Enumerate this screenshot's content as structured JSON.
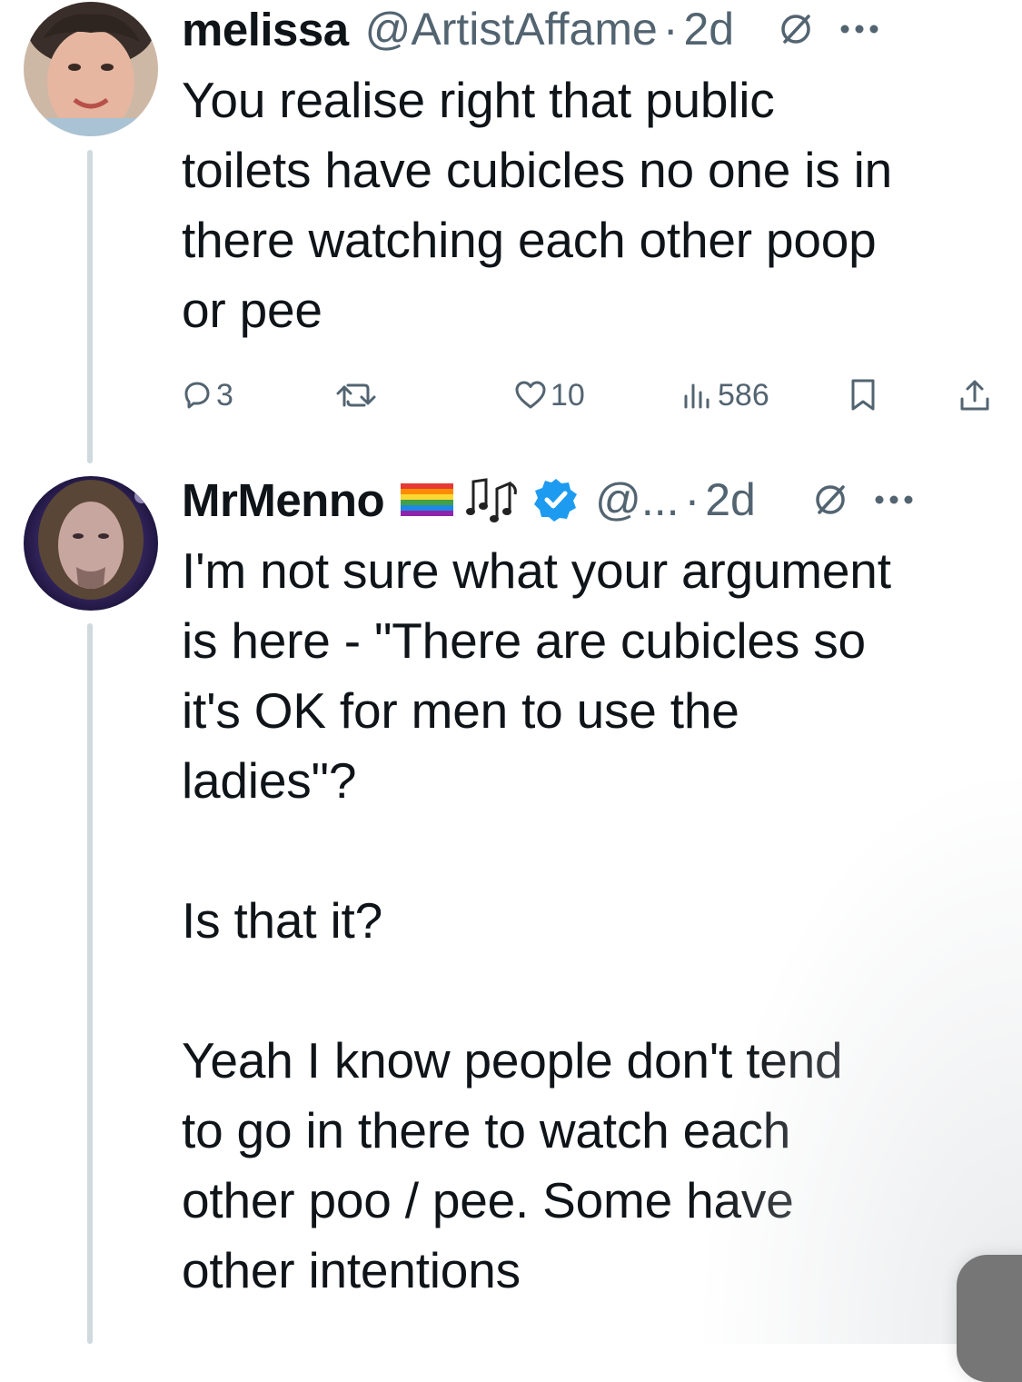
{
  "tweets": [
    {
      "author_name": "melissa",
      "handle": "@ArtistAffame",
      "separator": "·",
      "time": "2d",
      "text": "You realise right that public\ntoilets have cubicles no one is in\nthere watching each other poop\nor pee",
      "actions": {
        "reply_count": "3",
        "repost_count": "",
        "like_count": "10",
        "view_count": "586"
      },
      "icons": {
        "reply": "reply-icon",
        "repost": "repost-icon",
        "like": "heart-icon",
        "views": "views-chart-icon",
        "bookmark": "bookmark-icon",
        "share": "share-icon",
        "grok": "grok-icon",
        "more": "more-dots-icon"
      }
    },
    {
      "author_name": "MrMenno",
      "badges": [
        "rainbow-flag-emoji",
        "music-notes-emoji",
        "verified-badge"
      ],
      "handle": "@...",
      "separator": "·",
      "time": "2d",
      "text": "I'm not sure what your argument\nis here - \"There are cubicles so\nit's OK for men to use the\nladies\"?\n\nIs that it?\n\nYeah I know people don't tend\nto go in there to watch each\nother poo / pee. Some have\nother intentions",
      "icons": {
        "grok": "grok-icon",
        "more": "more-dots-icon"
      }
    }
  ],
  "colors": {
    "text": "#0f1419",
    "secondary": "#536471",
    "thread_line": "#cfd9de",
    "verified": "#1d9bf0"
  }
}
